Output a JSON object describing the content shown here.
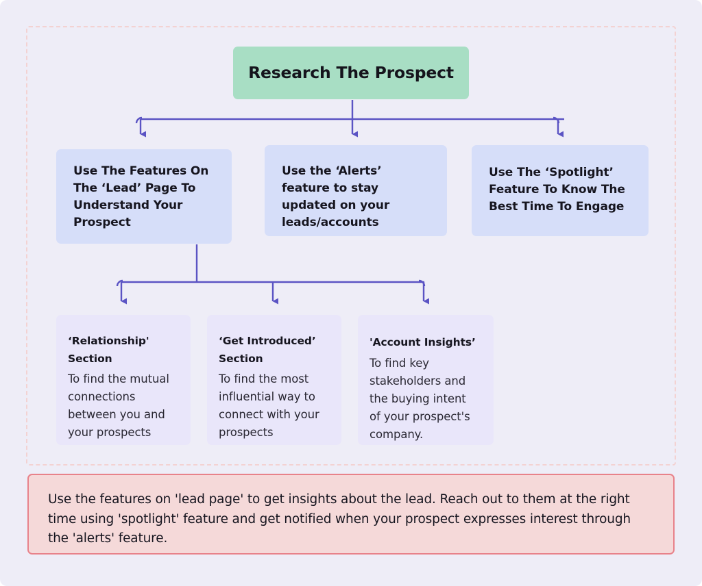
{
  "page": {
    "background_color": "#eeedf7",
    "frame_border_color": "#f3d2d2"
  },
  "flowchart": {
    "root": {
      "label": "Research The Prospect",
      "color": "#a8dec4"
    },
    "level2": [
      {
        "label": "Use The Features On The ‘Lead’ Page To Understand Your Prospect",
        "color": "#d6def9"
      },
      {
        "label": "Use the ‘Alerts’ feature to stay updated on your leads/accounts",
        "color": "#d6def9"
      },
      {
        "label": "Use The ‘Spotlight’ Feature To Know The Best Time To Engage",
        "color": "#d6def9"
      }
    ],
    "level3": [
      {
        "title": "‘Relationship' Section",
        "description": "To find the mutual connections between you and your prospects",
        "color": "#e9e6fa"
      },
      {
        "title": "‘Get Introduced’ Section",
        "description": "To find the most influential way to connect with your prospects",
        "color": "#e9e6fa"
      },
      {
        "title": "'Account Insights’",
        "description": "To find key stakeholders and the buying intent of your prospect's company.",
        "color": "#e9e6fa"
      }
    ],
    "connector_color": "#5b54c4"
  },
  "summary": {
    "text": "Use the features on 'lead page' to get insights about the lead. Reach out to them at the right time using 'spotlight' feature and get notified when your prospect expresses interest through the 'alerts' feature.",
    "background_color": "#f5d9d9",
    "border_color": "#e8828a"
  }
}
